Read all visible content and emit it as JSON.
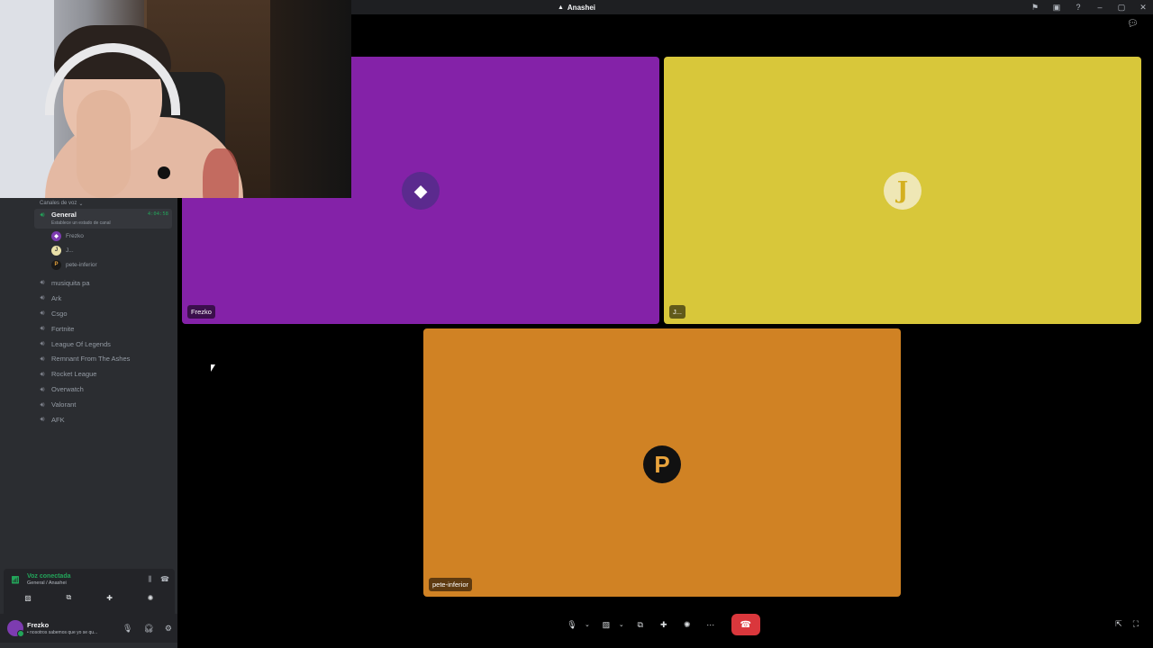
{
  "titlebar": {
    "title": "Anashei",
    "logo_icon": "server-logo-icon",
    "actions": [
      "flag-icon",
      "inbox-icon",
      "help-icon"
    ],
    "window_controls": [
      "minimize",
      "maximize",
      "close"
    ]
  },
  "sidebar": {
    "category": "Canales de voz",
    "active_channel": {
      "name": "General",
      "status": "Establece un estado de canal",
      "timer": "4:04:58",
      "members": [
        {
          "name": "Frezko",
          "avatar_color": "#7d3cb0"
        },
        {
          "name": "J...",
          "avatar_color": "#e9e0a8",
          "initial": "J"
        },
        {
          "name": "pete-inferior",
          "avatar_color": "#1a1a1a",
          "initial": "P"
        }
      ]
    },
    "channels": [
      "musiquita pa",
      "Ark",
      "Csgo",
      "Fortnite",
      "League Of Legends",
      "Remnant From The Ashes",
      "Rocket League",
      "Overwatch",
      "Valorant",
      "AFK"
    ]
  },
  "voice_panel": {
    "title": "Voz conectada",
    "subtitle": "General / Anashei"
  },
  "user": {
    "name": "Frezko",
    "status": "• nosotros sabemos que yo se qu..."
  },
  "tiles": [
    {
      "label": "Frezko",
      "color": "#8422a8"
    },
    {
      "label": "J...",
      "color": "#d8c73a"
    },
    {
      "label": "pete-inferior",
      "color": "#d08224"
    }
  ],
  "colors": {
    "accent_green": "#23a55a",
    "end_call_red": "#da373c",
    "sidebar_bg": "#2b2d31",
    "panel_bg": "#232428"
  }
}
